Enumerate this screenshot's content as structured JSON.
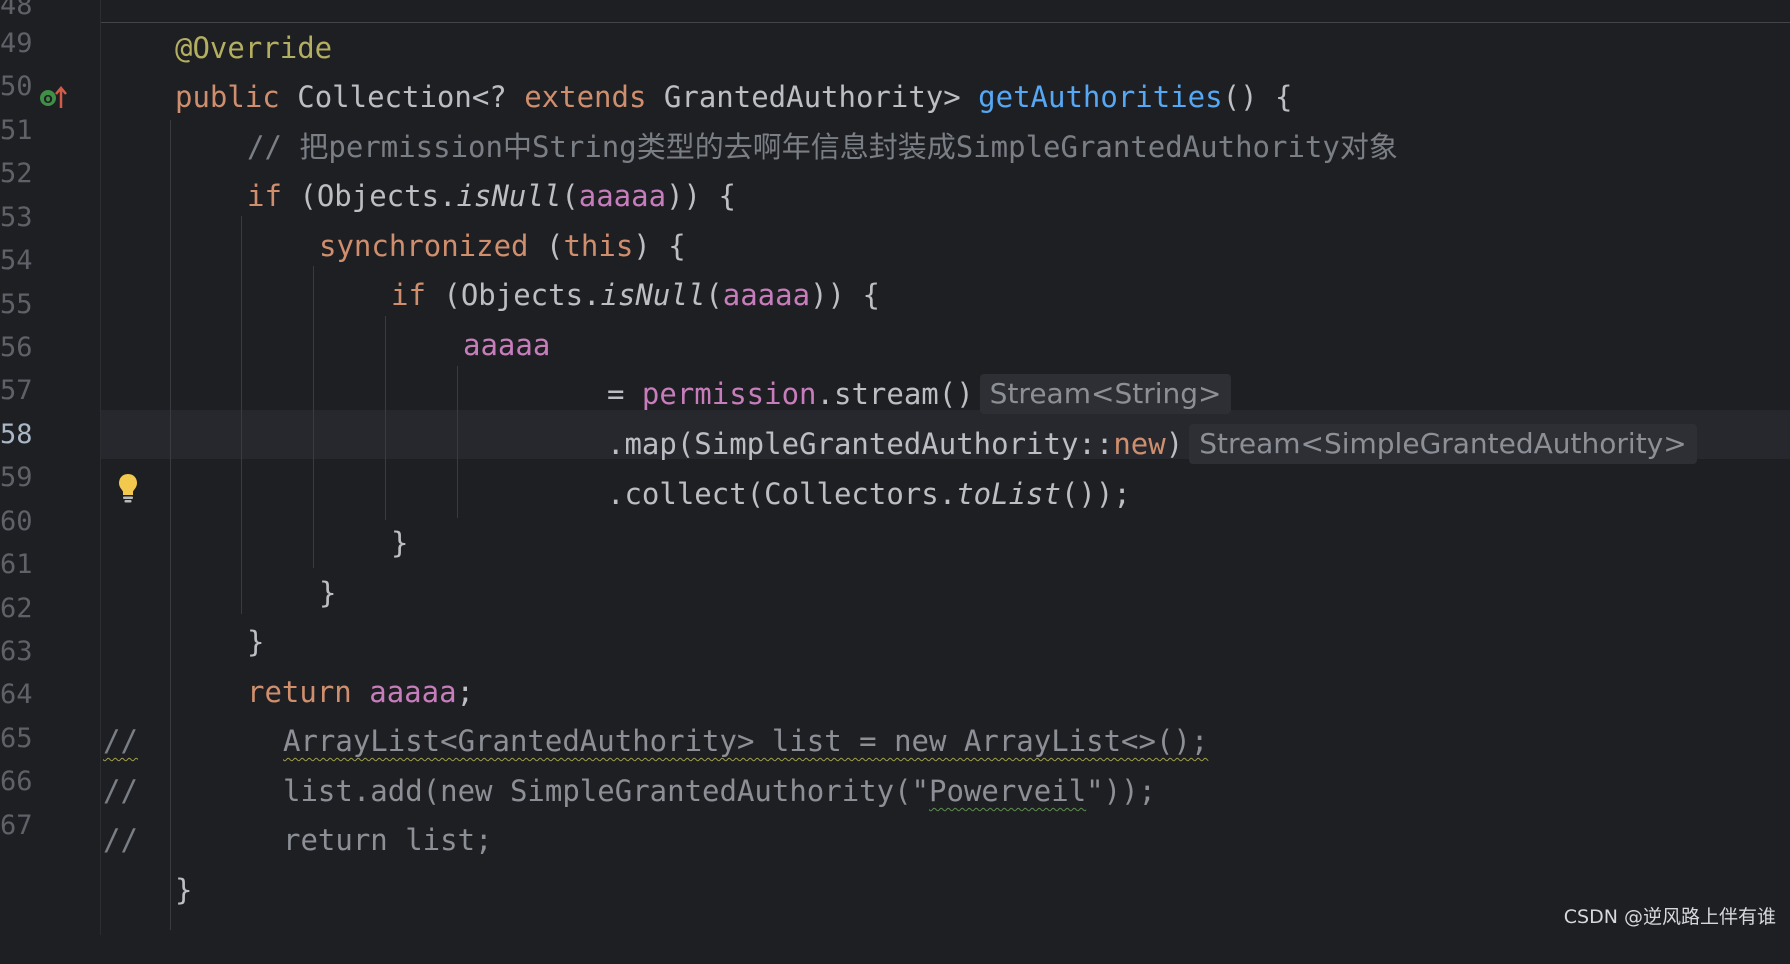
{
  "lines": [
    {
      "num": "48"
    },
    {
      "num": "49"
    },
    {
      "num": "50"
    },
    {
      "num": "51"
    },
    {
      "num": "52"
    },
    {
      "num": "53"
    },
    {
      "num": "54"
    },
    {
      "num": "55"
    },
    {
      "num": "56"
    },
    {
      "num": "57"
    },
    {
      "num": "58"
    },
    {
      "num": "59"
    },
    {
      "num": "60"
    },
    {
      "num": "61"
    },
    {
      "num": "62"
    },
    {
      "num": "63"
    },
    {
      "num": "64"
    },
    {
      "num": "65"
    },
    {
      "num": "66"
    },
    {
      "num": "67"
    }
  ],
  "code": {
    "l49": {
      "annotation": "@Override"
    },
    "l50": {
      "kw_public": "public",
      "type_collection": "Collection<? ",
      "kw_extends": "extends",
      "type_rest": " GrantedAuthority> ",
      "method": "getAuthorities",
      "tail": "() {"
    },
    "l51": {
      "comment": "// 把permission中String类型的去啊年信息封装成SimpleGrantedAuthority对象"
    },
    "l52": {
      "kw_if": "if",
      "p1": " (Objects.",
      "call": "isNull",
      "p2": "(",
      "field": "aaaaa",
      "p3": ")) {"
    },
    "l53": {
      "kw_sync": "synchronized",
      "p1": " (",
      "kw_this": "this",
      "p2": ") {"
    },
    "l54": {
      "kw_if": "if",
      "p1": " (Objects.",
      "call": "isNull",
      "p2": "(",
      "field": "aaaaa",
      "p3": ")) {"
    },
    "l55": {
      "field": "aaaaa"
    },
    "l56": {
      "p1": "= ",
      "field": "permission",
      "p2": ".stream()",
      "hint": "Stream<String>"
    },
    "l57": {
      "p1": ".map(SimpleGrantedAuthority::",
      "kw_new": "new",
      "p2": ")",
      "hint": "Stream<SimpleGrantedAuthority>"
    },
    "l58": {
      "p1": ".collect(Collectors.",
      "call": "toList",
      "p2": "());"
    },
    "l59": {
      "brace": "}"
    },
    "l60": {
      "brace": "}"
    },
    "l61": {
      "brace": "}"
    },
    "l62": {
      "kw_return": "return",
      "sp": " ",
      "field": "aaaaa",
      "p1": ";"
    },
    "l63": {
      "slashes": "//",
      "rest": "ArrayList<GrantedAuthority> list = new ArrayList<>();"
    },
    "l64": {
      "slashes": "//",
      "p1": "list.add(new SimpleGrantedAuthority(\"",
      "str": "Powerveil",
      "p2": "\"));"
    },
    "l65": {
      "slashes": "//",
      "rest": "return list;"
    },
    "l66": {
      "brace": "}"
    }
  },
  "gutter_icons": {
    "override_marker": "override-up-arrow-icon",
    "intention": "lightbulb-icon"
  },
  "watermark": "CSDN @逆风路上伴有谁",
  "colors": {
    "background": "#1e1f22",
    "keyword": "#cf8e6d",
    "annotation": "#b3ae60",
    "method": "#56a8f5",
    "field": "#c77dbb",
    "comment": "#7a7e85"
  }
}
